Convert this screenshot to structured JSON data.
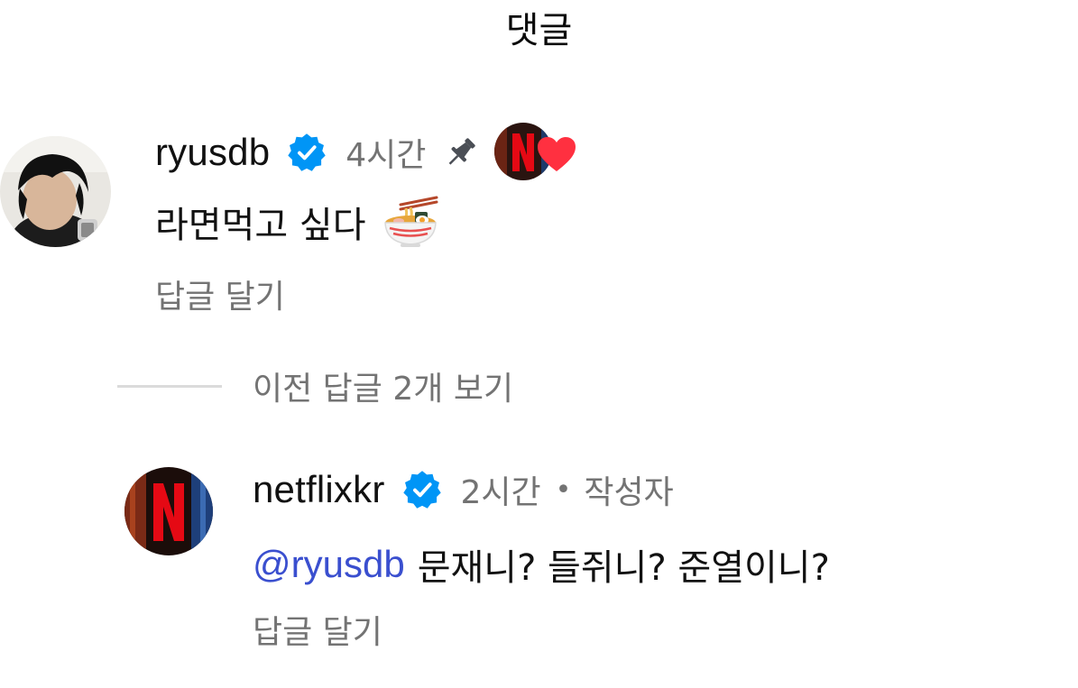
{
  "header": {
    "title": "댓글"
  },
  "comments": [
    {
      "username": "ryusdb",
      "verified": true,
      "time": "4시간",
      "pinned": true,
      "liked_by_creator": true,
      "text": "라면먹고 싶다",
      "emoji": "ramen-bowl-icon",
      "reply_label": "답글 달기"
    }
  ],
  "view_replies": {
    "label": "이전 답글 2개 보기"
  },
  "replies": [
    {
      "username": "netflixkr",
      "verified": true,
      "time": "2시간",
      "separator": "•",
      "author_label": "작성자",
      "mention": "@ryusdb",
      "text": "문재니? 들쥐니? 준열이니?",
      "reply_label": "답글 달기"
    }
  ],
  "colors": {
    "verified_blue": "#0095f6",
    "mention_blue": "#3a4fcf",
    "heart_red": "#ff3040",
    "secondary_text": "#737373",
    "netflix_red": "#e50914"
  }
}
